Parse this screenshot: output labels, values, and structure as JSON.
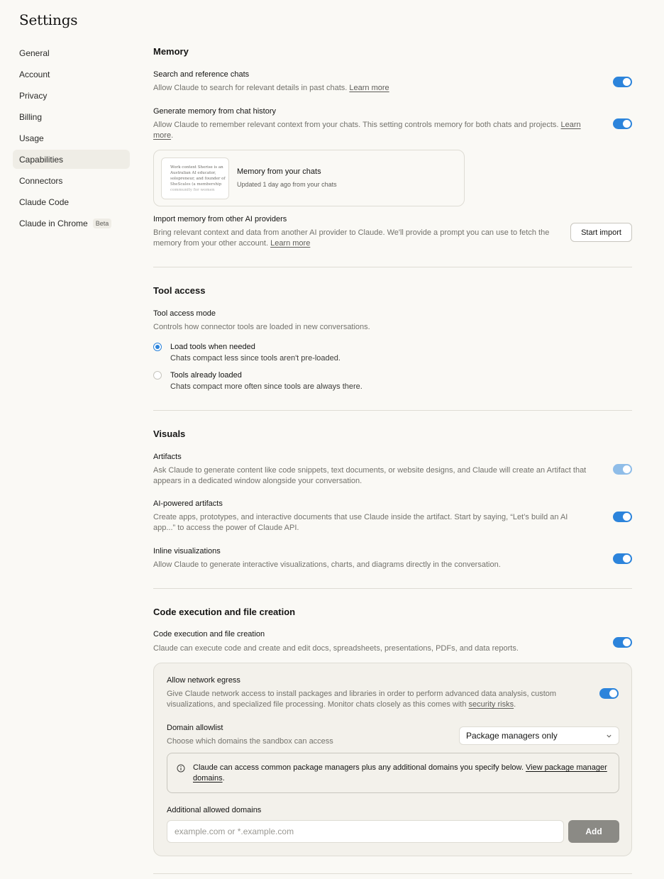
{
  "page_title": "Settings",
  "sidebar": {
    "items": [
      {
        "label": "General"
      },
      {
        "label": "Account"
      },
      {
        "label": "Privacy"
      },
      {
        "label": "Billing"
      },
      {
        "label": "Usage"
      },
      {
        "label": "Capabilities",
        "active": true
      },
      {
        "label": "Connectors"
      },
      {
        "label": "Claude Code"
      },
      {
        "label": "Claude in Chrome",
        "badge": "Beta"
      }
    ]
  },
  "memory": {
    "title": "Memory",
    "search_chats": {
      "title": "Search and reference chats",
      "desc": "Allow Claude to search for relevant details in past chats.",
      "link": "Learn more",
      "enabled": true
    },
    "generate_memory": {
      "title": "Generate memory from chat history",
      "desc": "Allow Claude to remember relevant context from your chats. This setting controls memory for both chats and projects.",
      "link": "Learn more",
      "enabled": true
    },
    "memory_card": {
      "preview_text": "Work context Sherise is an Australian AI educator, solopreneur, and founder of SheScales (a membership community for women",
      "title": "Memory from your chats",
      "updated": "Updated 1 day ago from your chats"
    },
    "import": {
      "title": "Import memory from other AI providers",
      "desc": "Bring relevant context and data from another AI provider to Claude. We'll provide a prompt you can use to fetch the memory from your other account.",
      "link": "Learn more",
      "button": "Start import"
    }
  },
  "tool_access": {
    "title": "Tool access",
    "mode_title": "Tool access mode",
    "mode_desc": "Controls how connector tools are loaded in new conversations.",
    "options": [
      {
        "label": "Load tools when needed",
        "desc": "Chats compact less since tools aren't pre-loaded.",
        "selected": true
      },
      {
        "label": "Tools already loaded",
        "desc": "Chats compact more often since tools are always there.",
        "selected": false
      }
    ]
  },
  "visuals": {
    "title": "Visuals",
    "artifacts": {
      "title": "Artifacts",
      "desc": "Ask Claude to generate content like code snippets, text documents, or website designs, and Claude will create an Artifact that appears in a dedicated window alongside your conversation.",
      "enabled": true
    },
    "ai_artifacts": {
      "title": "AI-powered artifacts",
      "desc": "Create apps, prototypes, and interactive documents that use Claude inside the artifact. Start by saying, “Let’s build an AI app...” to access the power of Claude API.",
      "enabled": true
    },
    "inline_viz": {
      "title": "Inline visualizations",
      "desc": "Allow Claude to generate interactive visualizations, charts, and diagrams directly in the conversation.",
      "enabled": true
    }
  },
  "code_exec": {
    "title": "Code execution and file creation",
    "row_title": "Code execution and file creation",
    "row_desc": "Claude can execute code and create and edit docs, spreadsheets, presentations, PDFs, and data reports.",
    "enabled": true,
    "egress": {
      "title": "Allow network egress",
      "desc": "Give Claude network access to install packages and libraries in order to perform advanced data analysis, custom visualizations, and specialized file processing. Monitor chats closely as this comes with",
      "link": "security risks",
      "enabled": true
    },
    "allowlist": {
      "title": "Domain allowlist",
      "desc": "Choose which domains the sandbox can access",
      "selected": "Package managers only"
    },
    "info": {
      "text": "Claude can access common package managers plus any additional domains you specify below.",
      "link": "View package manager domains"
    },
    "additional": {
      "title": "Additional allowed domains",
      "placeholder": "example.com or *.example.com",
      "add_label": "Add"
    }
  },
  "colors": {
    "accent": "#2c84db",
    "background": "#faf9f5",
    "panel": "#f3f1eb",
    "active_nav": "#efede6"
  }
}
